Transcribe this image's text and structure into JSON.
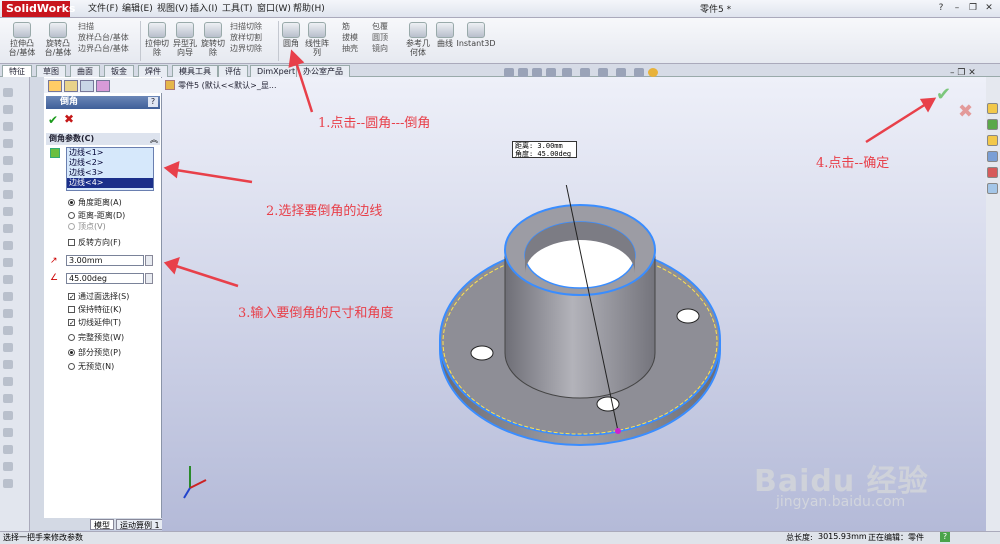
{
  "app": {
    "name": "SolidWorks",
    "doc_title": "零件5 *"
  },
  "menu": [
    "文件(F)",
    "编辑(E)",
    "视图(V)",
    "插入(I)",
    "工具(T)",
    "窗口(W)",
    "帮助(H)"
  ],
  "ribbon": {
    "big": [
      {
        "label": "拉伸凸\n台/基体"
      },
      {
        "label": "旋转凸\n台/基体"
      },
      {
        "label": "拉伸切\n除"
      },
      {
        "label": "异型孔\n向导"
      },
      {
        "label": "旋转切\n除"
      },
      {
        "label": "圆角"
      },
      {
        "label": "线性阵\n列"
      },
      {
        "label": "参考几\n何体"
      },
      {
        "label": "曲线"
      },
      {
        "label": "Instant3D"
      }
    ],
    "small_col1": [
      "扫描",
      "放样凸台/基体",
      "边界凸台/基体"
    ],
    "small_col2": [
      "扫描切除",
      "放样切割",
      "边界切除"
    ],
    "small_col3": [
      "筋",
      "拔模",
      "抽壳"
    ],
    "small_col4": [
      "包覆",
      "圆顶",
      "镜向"
    ]
  },
  "tabs": [
    "特征",
    "草图",
    "曲面",
    "钣金",
    "焊件",
    "模具工具",
    "评估",
    "DimXpert",
    "办公室产品"
  ],
  "feature_tree": {
    "root": "零件5",
    "config": "(默认<<默认>_显..."
  },
  "property_manager": {
    "title": "倒角",
    "help": "?",
    "group_title": "倒角参数(C)",
    "edges": [
      "边线<1>",
      "边线<2>",
      "边线<3>",
      "边线<4>"
    ],
    "selected_edge_index": 3,
    "options_type": [
      "角度距离(A)",
      "距离-距离(D)",
      "顶点(V)"
    ],
    "reverse_direction": "反转方向(F)",
    "distance": "3.00mm",
    "angle": "45.00deg",
    "checks": [
      "通过面选择(S)",
      "保持特征(K)",
      "切线延伸(T)"
    ],
    "preview": [
      "完整预览(W)",
      "部分预览(P)",
      "无预览(N)"
    ]
  },
  "bottom_tabs": [
    "模型",
    "运动算例 1"
  ],
  "callout": {
    "line1": "距离: 3.00mm",
    "line2": "角度: 45.00deg"
  },
  "annotations": {
    "a1": "1.点击--圆角---倒角",
    "a2": "2.选择要倒角的边线",
    "a3": "3.输入要倒角的尺寸和角度",
    "a4": "4.点击--确定"
  },
  "status": {
    "left": "选择一把手来修改参数",
    "length_label": "总长度:",
    "length_value": "3015.93mm",
    "editing": "正在编辑：零件"
  },
  "watermark": {
    "main": "Baidu 经验",
    "sub": "jingyan.baidu.com"
  },
  "colors": {
    "annotation": "#e8404a",
    "part": "#8b8b93",
    "edge_highlight": "#3a8dff",
    "selection": "#1b2f8a"
  }
}
